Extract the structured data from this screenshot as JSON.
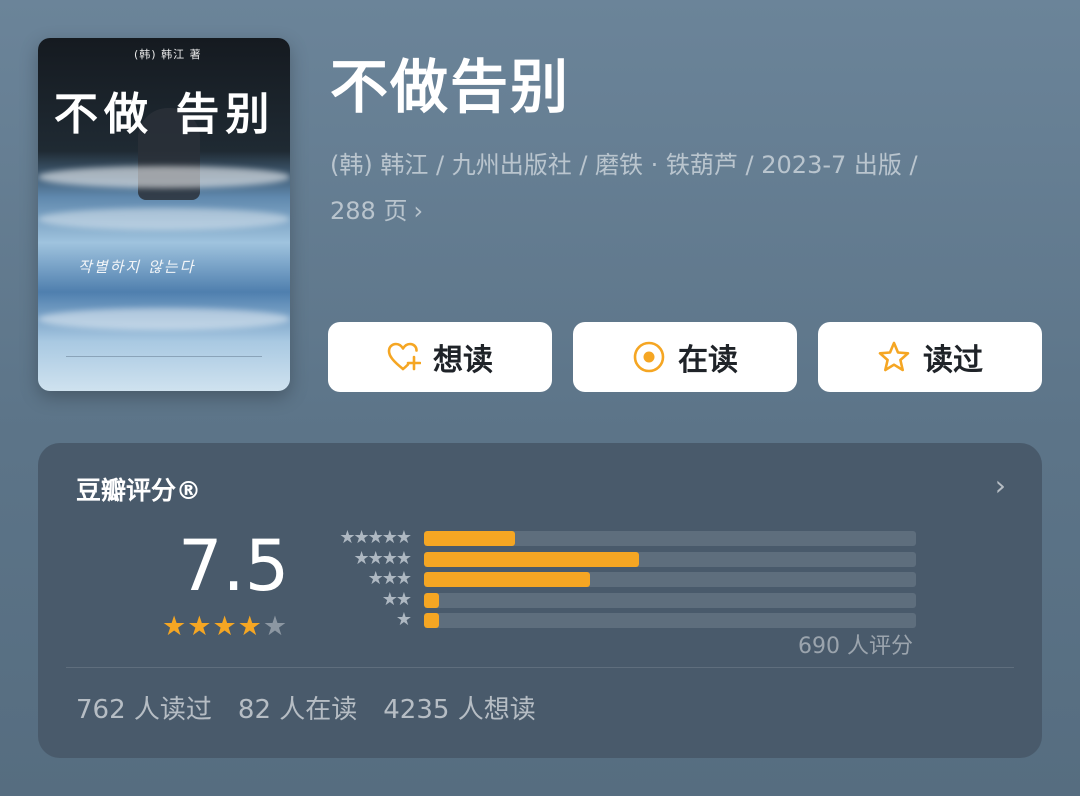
{
  "cover": {
    "author_tag": "(韩) 韩江 著",
    "title": "不做 告别",
    "korean_title": "작별하지 않는다"
  },
  "book": {
    "title": "不做告别",
    "meta_line1": "(韩) 韩江 / 九州出版社 / 磨铁 · 铁葫芦 / 2023-7 出版 /",
    "meta_line2": "288 页",
    "meta_chevron": "›"
  },
  "actions": [
    {
      "label": "想读",
      "icon": "heart-plus-icon"
    },
    {
      "label": "在读",
      "icon": "target-icon"
    },
    {
      "label": "读过",
      "icon": "star-icon"
    }
  ],
  "rating": {
    "header": "豆瓣评分®",
    "chevron": "›",
    "score": "7.5",
    "stars_value": 4,
    "stars_total": 5,
    "distribution": [
      {
        "stars": "★★★★★",
        "fraction": 0.185
      },
      {
        "stars": "★★★★",
        "fraction": 0.438
      },
      {
        "stars": "★★★",
        "fraction": 0.338
      },
      {
        "stars": "★★",
        "fraction": 0.03
      },
      {
        "stars": "★",
        "fraction": 0.03
      }
    ],
    "count": "690 人评分"
  },
  "stats": {
    "read": "762 人读过",
    "reading": "82 人在读",
    "want": "4235 人想读"
  },
  "colors": {
    "accent": "#f5a623",
    "card_bg": "#495a6b",
    "button_bg": "#ffffff"
  }
}
